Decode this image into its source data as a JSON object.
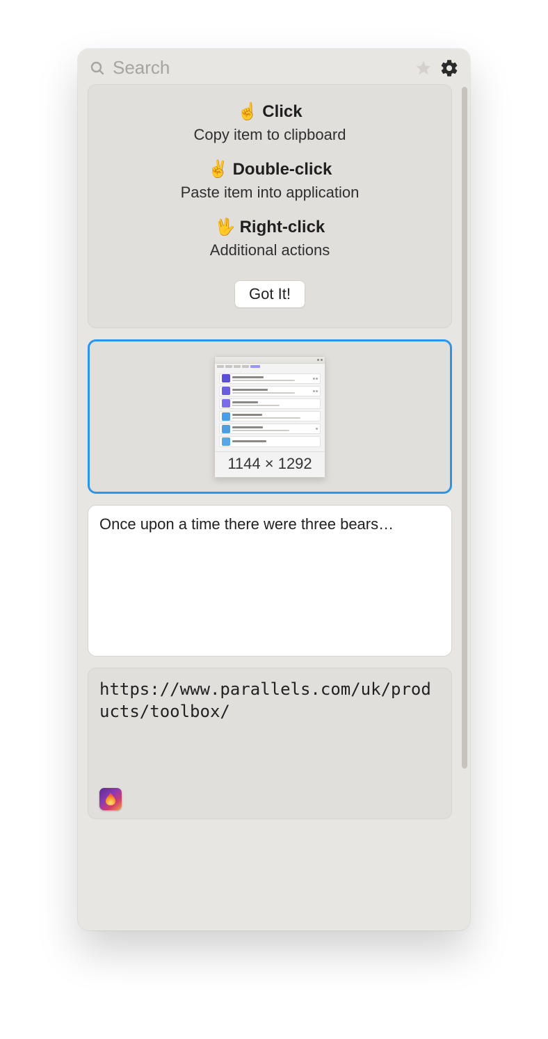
{
  "search": {
    "placeholder": "Search"
  },
  "tips": {
    "items": [
      {
        "emoji": "☝️",
        "title": "Click",
        "desc": "Copy item to clipboard"
      },
      {
        "emoji": "✌️",
        "title": "Double-click",
        "desc": "Paste item into application"
      },
      {
        "emoji": "🖖",
        "title": "Right-click",
        "desc": "Additional actions"
      }
    ],
    "button": "Got It!"
  },
  "clips": {
    "image": {
      "dimensions": "1144 × 1292"
    },
    "text": {
      "content": "Once upon a time there were three bears…"
    },
    "url": {
      "content": "https://www.parallels.com/uk/products/toolbox/",
      "source_app": "firefox"
    }
  }
}
